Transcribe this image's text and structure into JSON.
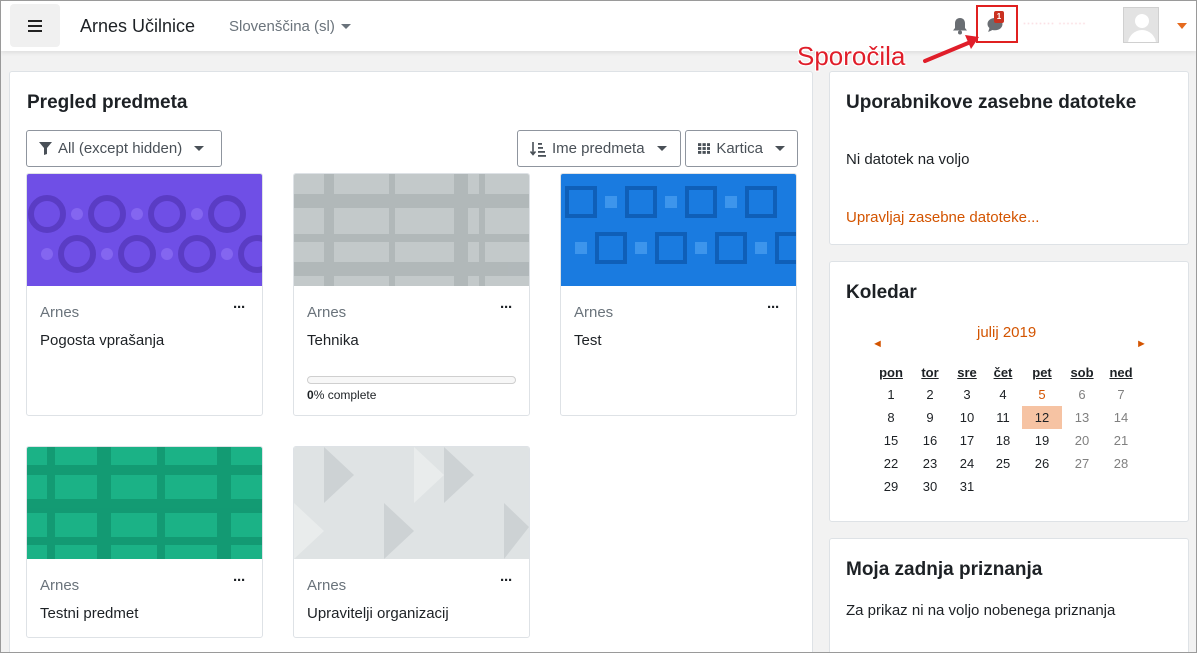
{
  "navbar": {
    "site_name": "Arnes Učilnice",
    "language": "Slovenščina (sl)",
    "messages_badge": "1",
    "username": "········ ·······",
    "icons": [
      "menu-icon",
      "bell-icon",
      "chat-icon",
      "user-avatar"
    ]
  },
  "annotation": {
    "label": "Sporočila",
    "color": "#e01e2a"
  },
  "course_overview": {
    "title": "Pregled predmeta",
    "filter_label": "All (except hidden)",
    "sort_label": "Ime predmeta",
    "view_label": "Kartica",
    "courses": [
      {
        "category": "Arnes",
        "name": "Pogosta vprašanja",
        "color": "#6f4fe6"
      },
      {
        "category": "Arnes",
        "name": "Tehnika",
        "color": "#bfc5c6",
        "progress": 0,
        "progress_suffix": "% complete"
      },
      {
        "category": "Arnes",
        "name": "Test",
        "color": "#1a7be0"
      },
      {
        "category": "Arnes",
        "name": "Testni predmet",
        "color": "#1bb286"
      },
      {
        "category": "Arnes",
        "name": "Upravitelji organizacij",
        "color": "#dfe3e4"
      }
    ],
    "more_label": "···"
  },
  "private_files": {
    "title": "Uporabnikove zasebne datoteke",
    "empty_text": "Ni datotek na voljo",
    "manage_link": "Upravljaj zasebne datoteke..."
  },
  "calendar": {
    "title": "Koledar",
    "month": "julij 2019",
    "prev": "◄",
    "next": "►",
    "weekdays": [
      "pon",
      "tor",
      "sre",
      "čet",
      "pet",
      "sob",
      "ned"
    ],
    "weeks": [
      [
        "1",
        "2",
        "3",
        "4",
        "5",
        "6",
        "7"
      ],
      [
        "8",
        "9",
        "10",
        "11",
        "12",
        "13",
        "14"
      ],
      [
        "15",
        "16",
        "17",
        "18",
        "19",
        "20",
        "21"
      ],
      [
        "22",
        "23",
        "24",
        "25",
        "26",
        "27",
        "28"
      ],
      [
        "29",
        "30",
        "31",
        "",
        "",
        "",
        ""
      ]
    ],
    "today": "12",
    "highlight_day": "5",
    "accent_color": "#d35400"
  },
  "badges": {
    "title": "Moja zadnja priznanja",
    "empty_text": "Za prikaz ni na voljo nobenega priznanja"
  }
}
